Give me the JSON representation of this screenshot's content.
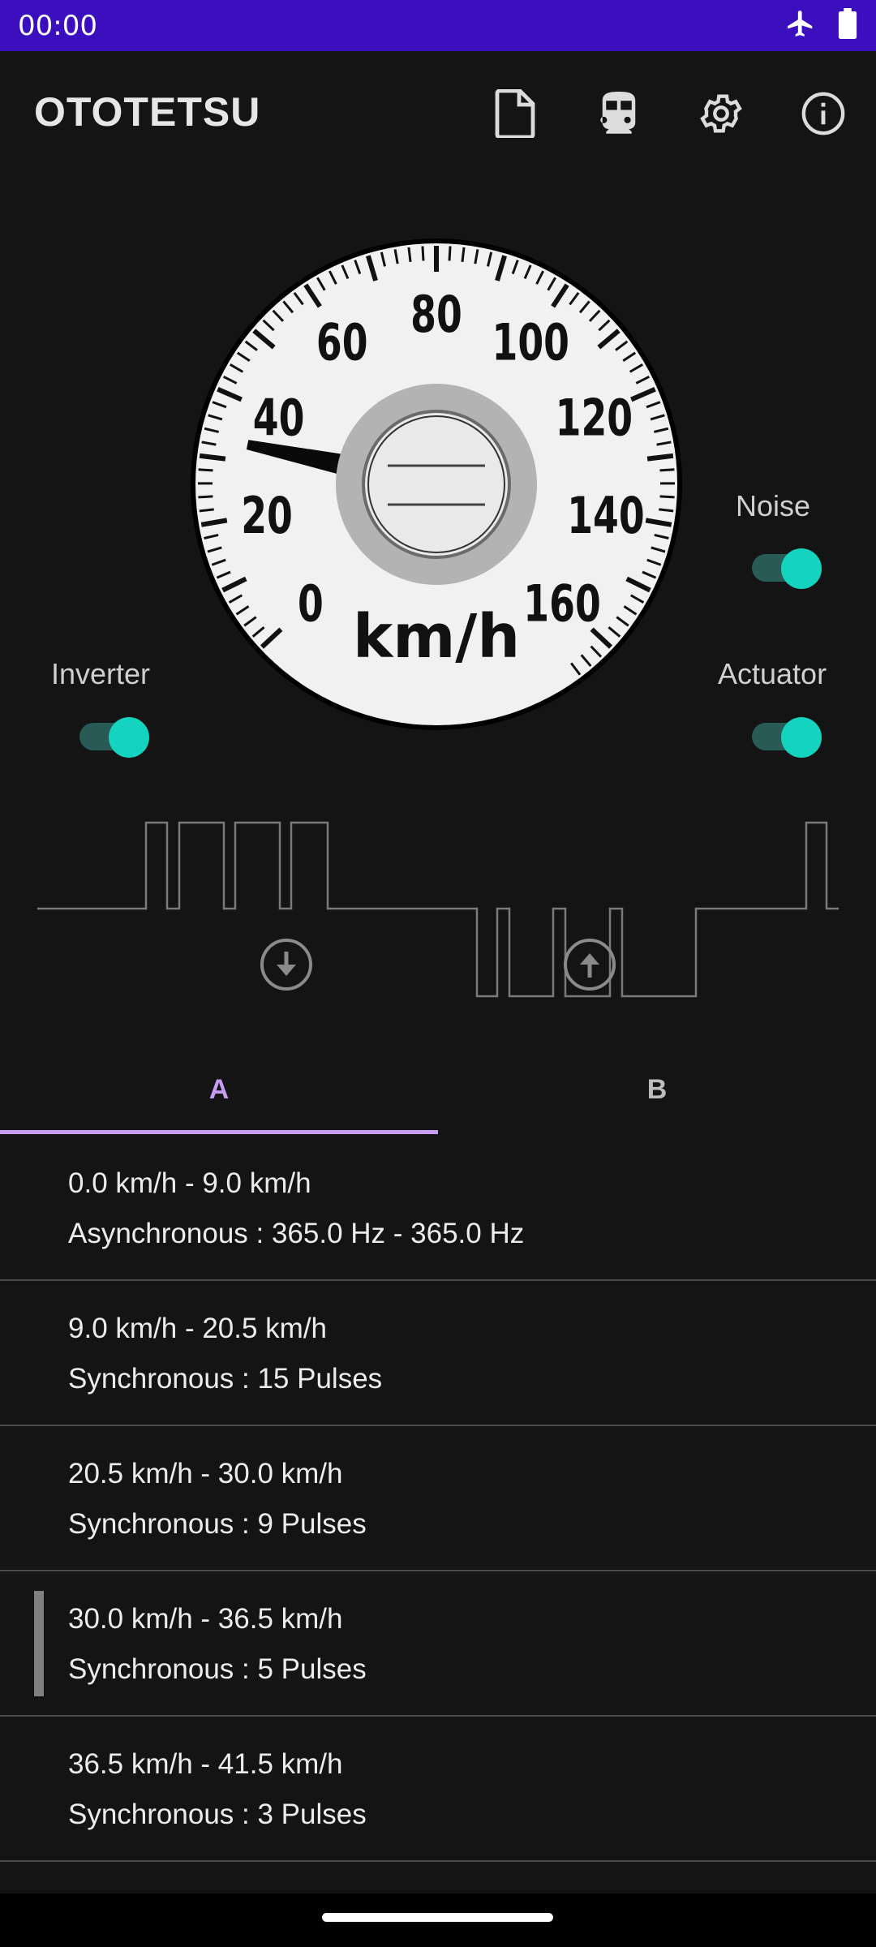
{
  "status_bar": {
    "time": "00:00"
  },
  "app_bar": {
    "title": "OTOTETSU",
    "actions": [
      "file-icon",
      "train-icon",
      "settings-icon",
      "info-icon"
    ]
  },
  "speedometer": {
    "unit": "km/h",
    "ticks": [
      "0",
      "20",
      "40",
      "60",
      "80",
      "100",
      "120",
      "140",
      "160"
    ],
    "current_speed": 33
  },
  "toggles": {
    "noise": {
      "label": "Noise",
      "on": true
    },
    "inverter": {
      "label": "Inverter",
      "on": true
    },
    "actuator": {
      "label": "Actuator",
      "on": true
    }
  },
  "tabs": {
    "a": "A",
    "b": "B",
    "selected": "A"
  },
  "list": [
    {
      "range": "0.0 km/h - 9.0 km/h",
      "mode": "Asynchronous : 365.0 Hz - 365.0 Hz"
    },
    {
      "range": "9.0 km/h - 20.5 km/h",
      "mode": "Synchronous : 15 Pulses"
    },
    {
      "range": "20.5 km/h - 30.0 km/h",
      "mode": "Synchronous : 9 Pulses"
    },
    {
      "range": "30.0 km/h - 36.5 km/h",
      "mode": "Synchronous : 5 Pulses",
      "active": true
    },
    {
      "range": "36.5 km/h - 41.5 km/h",
      "mode": "Synchronous : 3 Pulses"
    }
  ],
  "colors": {
    "status_bar": "#3b0fbd",
    "accent": "#14d4bf",
    "tab_selected": "#c69cf5",
    "background": "#141414"
  }
}
